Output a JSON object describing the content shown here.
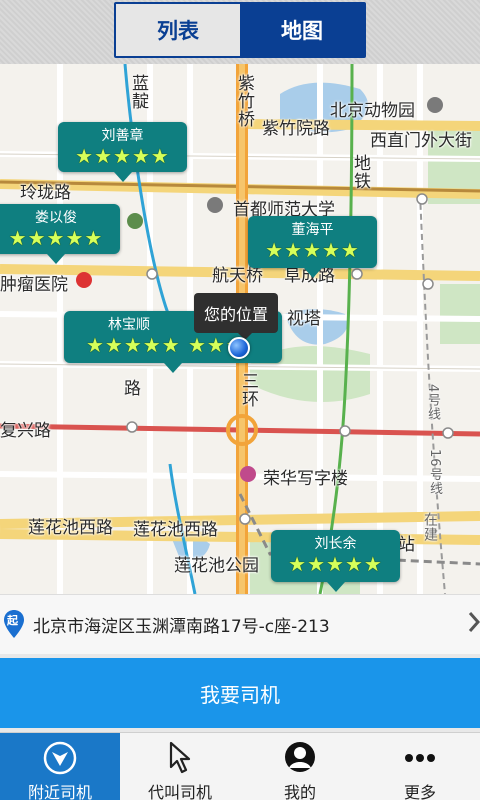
{
  "segment": {
    "list_label": "列表",
    "map_label": "地图",
    "selected": "地图"
  },
  "map": {
    "labels": {
      "zizhuqiao": "紫竹桥",
      "zizhuyuanlu": "紫竹院路",
      "beijingzoo": "北京动物园",
      "xizhimen": "西直门外大街",
      "linglonglu": "玲珑路",
      "shoudu": "首都师范大学",
      "hangtianqiao": "航天桥",
      "fuchenglu": "阜成路",
      "zhongliu": "肿瘤医院",
      "shita": "视塔",
      "road_lu": "路",
      "sanhuan": "三环",
      "fuxinglu": "复兴路",
      "ronghua": "荣华写字楼",
      "lianhuachixilu1": "莲花池西路",
      "lianhuachixilu2": "莲花池西路",
      "lianhuachipark": "莲花池公园",
      "station": "站",
      "ditie": "地铁",
      "landian": "蓝靛",
      "zaijian": "在建",
      "ditie4": "4号线",
      "ditie16": "16号线"
    },
    "drivers": [
      {
        "name": "刘善章",
        "stars": 5
      },
      {
        "name": "娄以俊",
        "stars": 5
      },
      {
        "name": "董海平",
        "stars": 5
      },
      {
        "name": "林宝顺",
        "stars": 5
      },
      {
        "name": "刘长余",
        "stars": 5
      }
    ],
    "tooltip": "您的位置"
  },
  "address": {
    "start_badge": "起",
    "text": "北京市海淀区玉渊潭南路17号-c座-213"
  },
  "cta_label": "我要司机",
  "tabs": [
    {
      "label": "附近司机",
      "icon": "nearby-icon"
    },
    {
      "label": "代叫司机",
      "icon": "cursor-icon"
    },
    {
      "label": "我的",
      "icon": "user-icon"
    },
    {
      "label": "更多",
      "icon": "more-icon"
    }
  ],
  "colors": {
    "brand": "#0a3f93",
    "cta": "#1a95ea",
    "pin": "#0f7f80",
    "active_tab": "#1a78c8"
  }
}
